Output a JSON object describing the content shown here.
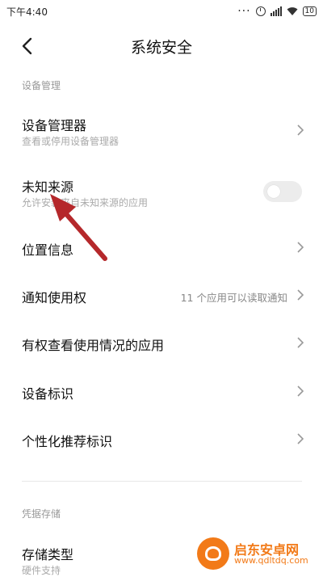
{
  "status": {
    "time": "下午4:40",
    "battery": "10",
    "dots": "···"
  },
  "header": {
    "title": "系统安全"
  },
  "sections": {
    "device_management": "设备管理",
    "credential_storage": "凭据存储"
  },
  "rows": {
    "device_admin": {
      "title": "设备管理器",
      "subtitle": "查看或停用设备管理器"
    },
    "unknown_sources": {
      "title": "未知来源",
      "subtitle": "允许安装来自未知来源的应用",
      "enabled": false
    },
    "location": {
      "title": "位置信息"
    },
    "notification_access": {
      "title": "通知使用权",
      "value": "11 个应用可以读取通知"
    },
    "usage_access": {
      "title": "有权查看使用情况的应用"
    },
    "device_id": {
      "title": "设备标识"
    },
    "personalized_id": {
      "title": "个性化推荐标识"
    },
    "storage_type": {
      "title": "存储类型",
      "subtitle": "硬件支持"
    }
  },
  "watermark": {
    "title": "启东安卓网",
    "url": "www.qdltdq.com"
  },
  "colors": {
    "arrow": "#b5282b",
    "accent": "#f27a18"
  }
}
